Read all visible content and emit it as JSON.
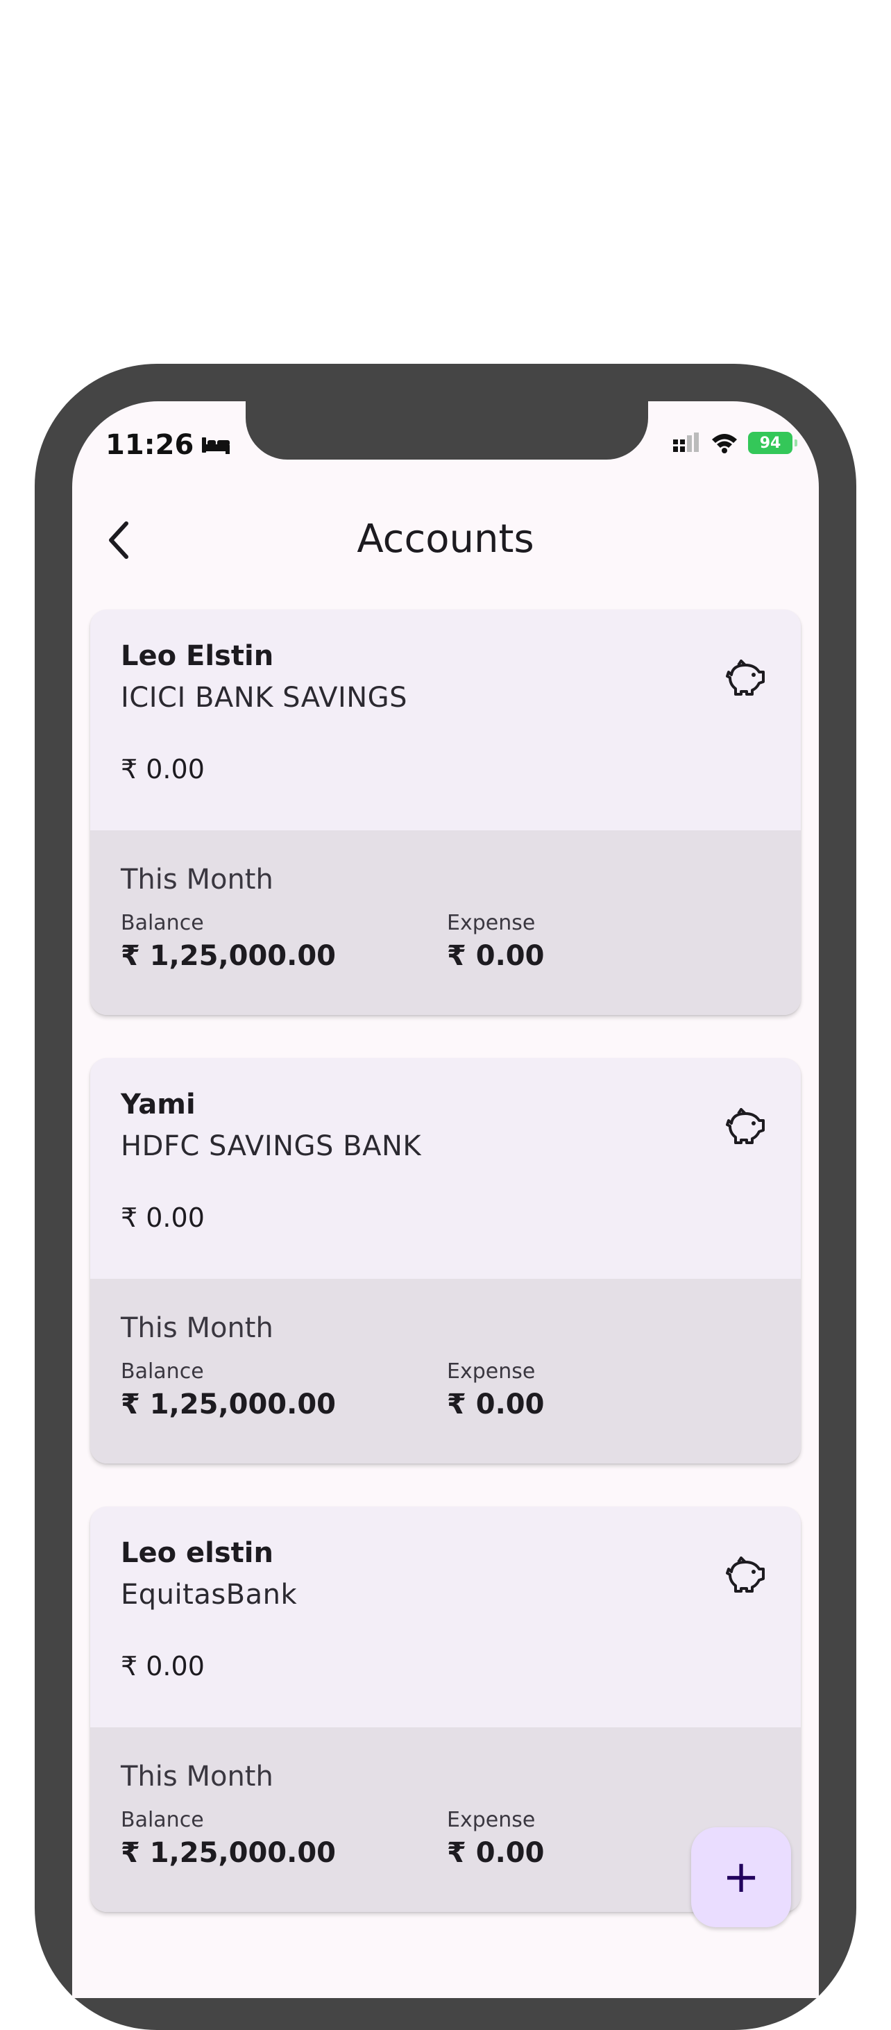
{
  "status_bar": {
    "time": "11:26",
    "battery": "94"
  },
  "header": {
    "title": "Accounts"
  },
  "accounts": [
    {
      "holder": "Leo Elstin",
      "bank": "ICICI BANK SAVINGS",
      "amount": "₹ 0.00",
      "period_label": "This Month",
      "balance_label": "Balance",
      "balance_value": "₹ 1,25,000.00",
      "expense_label": "Expense",
      "expense_value": "₹ 0.00"
    },
    {
      "holder": "Yami",
      "bank": "HDFC SAVINGS BANK",
      "amount": "₹ 0.00",
      "period_label": "This Month",
      "balance_label": "Balance",
      "balance_value": "₹ 1,25,000.00",
      "expense_label": "Expense",
      "expense_value": "₹ 0.00"
    },
    {
      "holder": "Leo elstin",
      "bank": "EquitasBank",
      "amount": "₹ 0.00",
      "period_label": "This Month",
      "balance_label": "Balance",
      "balance_value": "₹ 1,25,000.00",
      "expense_label": "Expense",
      "expense_value": "₹ 0.00"
    }
  ],
  "fab": {
    "label": "+"
  },
  "icons": {
    "back": "chevron-left-icon",
    "account": "piggy-bank-icon",
    "add": "plus-icon",
    "status": [
      "bed-icon",
      "signal-icon",
      "wifi-icon",
      "battery-icon"
    ]
  },
  "colors": {
    "background": "#fdf8fb",
    "card": "#f3eef7",
    "card_footer": "#e4dfe6",
    "fab": "#eaddff",
    "fab_icon": "#21005d",
    "device_frame": "#454545",
    "battery": "#34c759"
  }
}
